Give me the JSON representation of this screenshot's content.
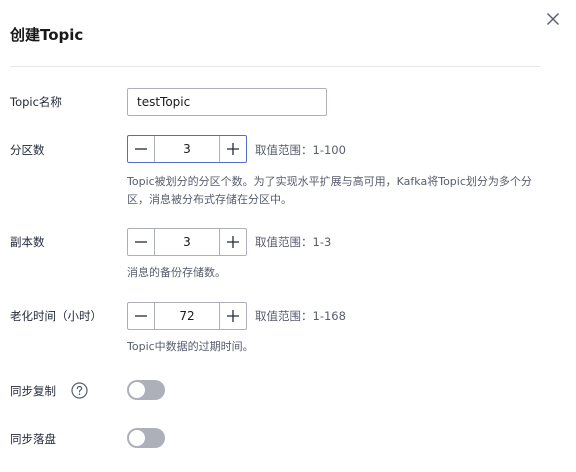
{
  "dialog": {
    "title": "创建Topic",
    "close_icon": "close-icon"
  },
  "form": {
    "topic_name": {
      "label": "Topic名称",
      "value": "testTopic"
    },
    "partitions": {
      "label": "分区数",
      "value": "3",
      "range": "取值范围：1-100",
      "help": "Topic被划分的分区个数。为了实现水平扩展与高可用，Kafka将Topic划分为多个分区，消息被分布式存储在分区中。"
    },
    "replicas": {
      "label": "副本数",
      "value": "3",
      "range": "取值范围：1-3",
      "help": "消息的备份存储数。"
    },
    "retention": {
      "label": "老化时间（小时）",
      "value": "72",
      "range": "取值范围：1-168",
      "help": "Topic中数据的过期时间。"
    },
    "sync_replication": {
      "label": "同步复制",
      "enabled": false,
      "help_icon": "question-circle-icon"
    },
    "sync_flush": {
      "label": "同步落盘",
      "enabled": false
    }
  },
  "colors": {
    "border": "#adb0b8",
    "focus": "#526ecc",
    "toggle_off": "#adb0b8",
    "text": "#252b3a",
    "muted": "#575d6c"
  }
}
